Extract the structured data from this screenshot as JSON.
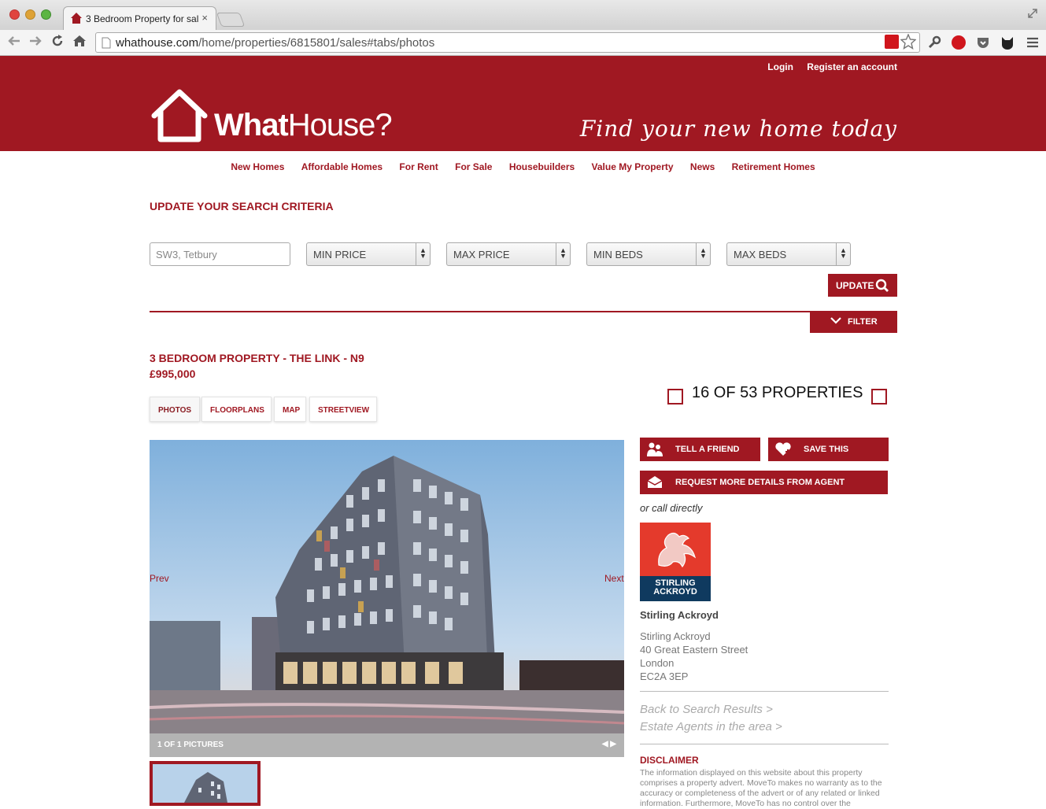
{
  "browser": {
    "tab_title": "3 Bedroom Property for sal",
    "close_glyph": "×",
    "url_host": "whathouse.com",
    "url_path": "/home/properties/6815801/sales#tabs/photos"
  },
  "header": {
    "login": "Login",
    "register": "Register an account",
    "logo_bold": "What",
    "logo_light": "House?",
    "tagline": "Find your new home today"
  },
  "nav": {
    "items": [
      "New Homes",
      "Affordable Homes",
      "For Rent",
      "For Sale",
      "Housebuilders",
      "Value My Property",
      "News",
      "Retirement Homes"
    ]
  },
  "search": {
    "title": "UPDATE YOUR SEARCH CRITERIA",
    "location_placeholder": "SW3, Tetbury",
    "min_price": "MIN PRICE",
    "max_price": "MAX PRICE",
    "min_beds": "MIN BEDS",
    "max_beds": "MAX BEDS",
    "update_label": "UPDATE",
    "filter_label": "FILTER"
  },
  "property": {
    "title": "3 BEDROOM PROPERTY - THE LINK - N9",
    "price": "£995,000",
    "counter": "16 OF 53 PROPERTIES",
    "tabs": [
      "PHOTOS",
      "FLOORPLANS",
      "MAP",
      "STREETVIEW"
    ],
    "prev": "Prev",
    "next": "Next",
    "pictures_caption": "1 OF 1 PICTURES"
  },
  "actions": {
    "tell_friend": "TELL A FRIEND",
    "save_this": "SAVE THIS",
    "request_details": "REQUEST MORE DETAILS FROM AGENT",
    "or_call": "or call directly"
  },
  "agent": {
    "logo_line1": "STIRLING",
    "logo_line2": "ACKROYD",
    "name": "Stirling Ackroyd",
    "address": [
      "Stirling Ackroyd",
      "40 Great Eastern Street",
      "London",
      "EC2A 3EP"
    ],
    "back_link": "Back to Search Results >",
    "agents_link": "Estate Agents in the area >"
  },
  "disclaimer": {
    "title": "DISCLAIMER",
    "text": "The information displayed on this website about this property comprises a property advert. MoveTo makes no warranty as to the accuracy or completeness of the advert or of any related or linked information. Furthermore, MoveTo has no control over the"
  },
  "colors": {
    "brand": "#a01822",
    "agent_red": "#e43a2c",
    "agent_blue": "#0f3a5f"
  }
}
